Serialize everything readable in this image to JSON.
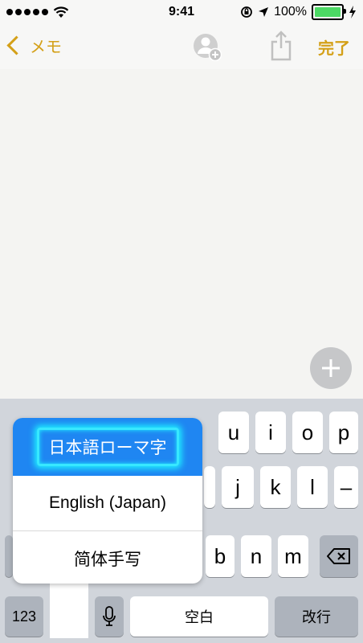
{
  "status": {
    "time": "9:41",
    "battery": "100%",
    "battery_level": 1.0
  },
  "nav": {
    "back_label": "メモ",
    "done_label": "完了"
  },
  "icons": {
    "wifi": "wifi-icon",
    "rotation_lock": "rotation-lock-icon",
    "location": "location-arrow-icon",
    "charging": "charging-bolt-icon",
    "add_person": "add-person-icon",
    "share": "share-icon",
    "add": "plus-icon",
    "delete": "backspace-icon",
    "mic": "microphone-icon"
  },
  "colors": {
    "accent": "#d4a018",
    "selection": "#1f86f2",
    "glow": "#38e8ff"
  },
  "keyboard": {
    "row1": [
      "u",
      "i",
      "o",
      "p"
    ],
    "row2": [
      "j",
      "k",
      "l",
      "–"
    ],
    "row3": [
      "b",
      "n",
      "m"
    ],
    "key_123": "123",
    "space": "空白",
    "return": "改行"
  },
  "language_menu": {
    "items": [
      "日本語ローマ字",
      "English (Japan)",
      "简体手写"
    ],
    "selected_index": 0
  }
}
